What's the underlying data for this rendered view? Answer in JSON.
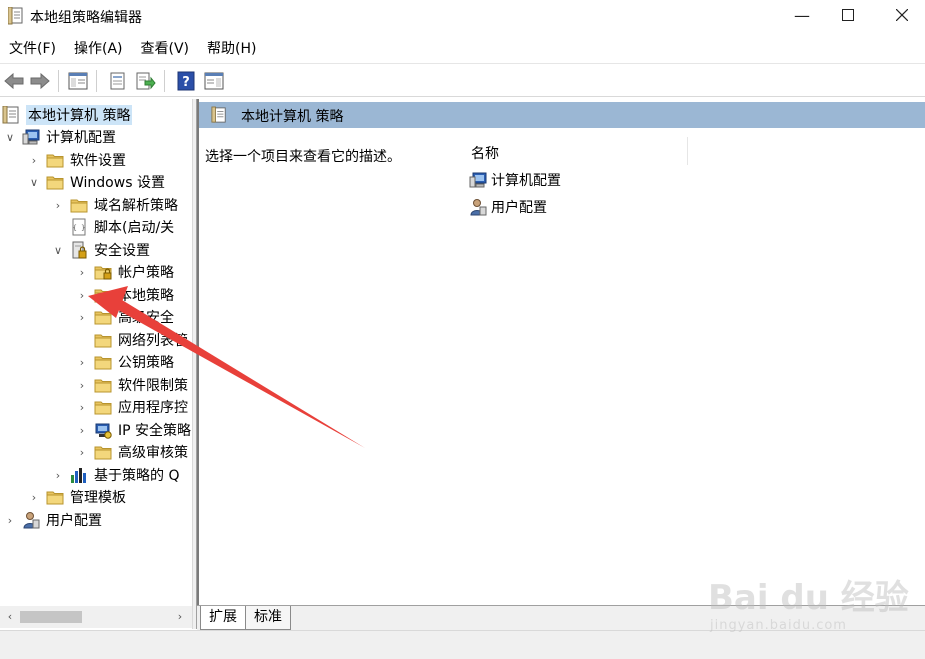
{
  "window": {
    "title": "本地组策略编辑器",
    "min_glyph": "—",
    "max_glyph": "☐",
    "close_glyph": "✕"
  },
  "menu": [
    "文件(F)",
    "操作(A)",
    "查看(V)",
    "帮助(H)"
  ],
  "toolbar": {
    "icons": [
      "back-arrow-icon",
      "forward-arrow-icon",
      "show-hide-console-tree-icon",
      "properties-icon",
      "export-list-icon",
      "help-icon",
      "show-hide-action-pane-icon"
    ]
  },
  "tree": {
    "root": "本地计算机 策略",
    "computer_config": "计算机配置",
    "software_settings": "软件设置",
    "windows_settings": "Windows 设置",
    "dns_policy": "域名解析策略",
    "scripts": "脚本(启动/关",
    "security_settings": "安全设置",
    "account_policies": "帐户策略",
    "local_policies": "本地策略",
    "advanced_security": "高级安全",
    "network_list": "网络列表管",
    "public_key": "公钥策略",
    "software_restriction": "软件限制策",
    "app_control": "应用程序控",
    "ip_security": "IP 安全策略",
    "advanced_audit": "高级审核策",
    "qos": "基于策略的 Q",
    "admin_templates": "管理模板",
    "user_config": "用户配置"
  },
  "right": {
    "header": "本地计算机 策略",
    "description": "选择一个项目来查看它的描述。",
    "column_name": "名称",
    "items": [
      "计算机配置",
      "用户配置"
    ]
  },
  "tabs": [
    "扩展",
    "标准"
  ],
  "watermark": {
    "main": "Bai du 经验",
    "sub": "jingyan.baidu.com"
  },
  "colors": {
    "selection": "#cce4f7",
    "header_bg": "#9bb7d4",
    "folder": "#e8c460",
    "arrow": "#e8403a"
  }
}
